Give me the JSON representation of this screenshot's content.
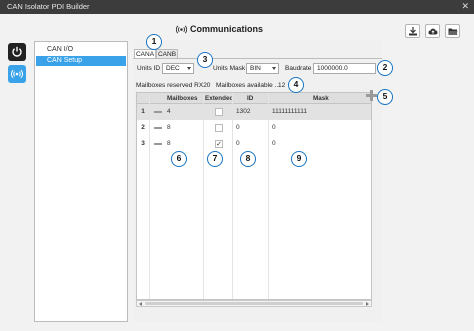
{
  "window": {
    "title": "CAN Isolator PDI Builder",
    "close_glyph": "✕"
  },
  "header": {
    "title": "Communications",
    "icon": "broadcast-icon",
    "actions": [
      "download-icon",
      "cloud-upload-icon",
      "folder-open-icon"
    ]
  },
  "sidebar": {
    "buttons": [
      "power-icon",
      "broadcast-icon"
    ],
    "items": [
      {
        "label": "CAN I/O",
        "selected": false
      },
      {
        "label": "CAN Setup",
        "selected": true
      }
    ]
  },
  "tabs": [
    {
      "label": "CANA",
      "active": true
    },
    {
      "label": "CANB",
      "active": false
    }
  ],
  "settings": {
    "units_id_label": "Units ID",
    "units_id_value": "DEC",
    "units_mask_label": "Units Mask",
    "units_mask_value": "BIN",
    "baudrate_label": "Baudrate",
    "baudrate_value": "1000000.0",
    "mailboxes_reserved": "Mailboxes reserved RX20",
    "mailboxes_available_label": "Mailboxes available ...",
    "mailboxes_available_value": "12"
  },
  "table": {
    "columns": [
      "Mailboxes",
      "Extended",
      "ID",
      "Mask"
    ],
    "rows": [
      {
        "num": "1",
        "mailboxes": "4",
        "extended": false,
        "id": "1302",
        "mask": "11111111111",
        "selected": true
      },
      {
        "num": "2",
        "mailboxes": "8",
        "extended": false,
        "id": "0",
        "mask": "0",
        "selected": false
      },
      {
        "num": "3",
        "mailboxes": "8",
        "extended": true,
        "id": "0",
        "mask": "0",
        "selected": false
      }
    ]
  },
  "callouts": [
    "1",
    "2",
    "3",
    "4",
    "5",
    "6",
    "7",
    "8",
    "9"
  ],
  "colors": {
    "accent": "#3aa2e8",
    "callout_border": "#1a73c2",
    "titlebar": "#3c3c3c",
    "add_icon": "#9a9a9a"
  }
}
